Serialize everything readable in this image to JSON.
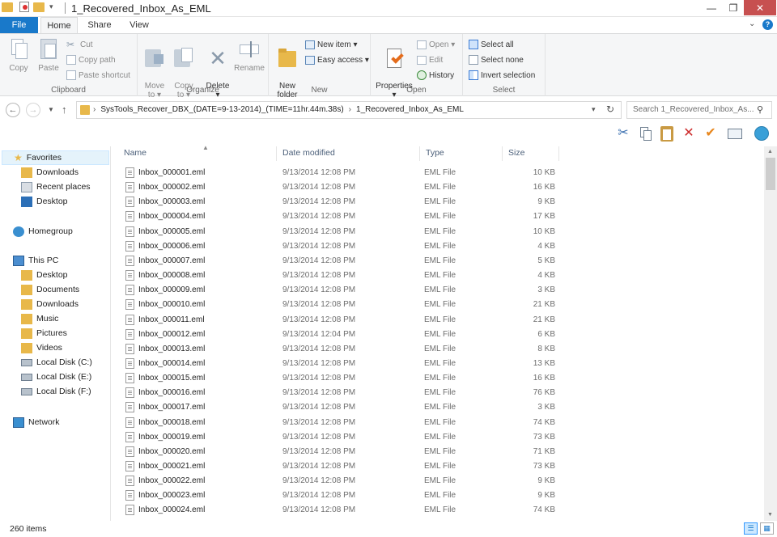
{
  "window": {
    "title": "1_Recovered_Inbox_As_EML",
    "min_glyph": "—",
    "max_glyph": "❐",
    "close_glyph": "✕"
  },
  "ribbon_tabs": {
    "file": "File",
    "home": "Home",
    "share": "Share",
    "view": "View",
    "help": "?"
  },
  "ribbon": {
    "clipboard": {
      "label": "Clipboard",
      "copy": "Copy",
      "paste": "Paste",
      "cut": "Cut",
      "copy_path": "Copy path",
      "paste_shortcut": "Paste shortcut"
    },
    "organize": {
      "label": "Organize",
      "move_to": "Move\nto ▾",
      "copy_to": "Copy\nto ▾",
      "delete": "Delete\n▾",
      "rename": "Rename"
    },
    "new": {
      "label": "New",
      "new_folder": "New\nfolder",
      "new_item": "New item ▾",
      "easy_access": "Easy access ▾"
    },
    "open": {
      "label": "Open",
      "properties": "Properties\n▾",
      "open": "Open ▾",
      "edit": "Edit",
      "history": "History"
    },
    "select": {
      "label": "Select",
      "select_all": "Select all",
      "select_none": "Select none",
      "invert_selection": "Invert selection"
    }
  },
  "address": {
    "crumbs": [
      "SysTools_Recover_DBX_(DATE=9-13-2014)_(TIME=11hr.44m.38s)",
      "1_Recovered_Inbox_As_EML"
    ],
    "search_placeholder": "Search 1_Recovered_Inbox_As..."
  },
  "nav": {
    "favorites": "Favorites",
    "favorites_items": [
      "Downloads",
      "Recent places",
      "Desktop"
    ],
    "homegroup": "Homegroup",
    "this_pc": "This PC",
    "this_pc_items": [
      "Desktop",
      "Documents",
      "Downloads",
      "Music",
      "Pictures",
      "Videos",
      "Local Disk (C:)",
      "Local Disk (E:)",
      "Local Disk (F:)"
    ],
    "network": "Network"
  },
  "columns": {
    "name": "Name",
    "date_modified": "Date modified",
    "type": "Type",
    "size": "Size"
  },
  "files": [
    {
      "name": "Inbox_000001.eml",
      "date": "9/13/2014 12:08 PM",
      "type": "EML File",
      "size": "10 KB"
    },
    {
      "name": "Inbox_000002.eml",
      "date": "9/13/2014 12:08 PM",
      "type": "EML File",
      "size": "16 KB"
    },
    {
      "name": "Inbox_000003.eml",
      "date": "9/13/2014 12:08 PM",
      "type": "EML File",
      "size": "9 KB"
    },
    {
      "name": "Inbox_000004.eml",
      "date": "9/13/2014 12:08 PM",
      "type": "EML File",
      "size": "17 KB"
    },
    {
      "name": "Inbox_000005.eml",
      "date": "9/13/2014 12:08 PM",
      "type": "EML File",
      "size": "10 KB"
    },
    {
      "name": "Inbox_000006.eml",
      "date": "9/13/2014 12:08 PM",
      "type": "EML File",
      "size": "4 KB"
    },
    {
      "name": "Inbox_000007.eml",
      "date": "9/13/2014 12:08 PM",
      "type": "EML File",
      "size": "5 KB"
    },
    {
      "name": "Inbox_000008.eml",
      "date": "9/13/2014 12:08 PM",
      "type": "EML File",
      "size": "4 KB"
    },
    {
      "name": "Inbox_000009.eml",
      "date": "9/13/2014 12:08 PM",
      "type": "EML File",
      "size": "3 KB"
    },
    {
      "name": "Inbox_000010.eml",
      "date": "9/13/2014 12:08 PM",
      "type": "EML File",
      "size": "21 KB"
    },
    {
      "name": "Inbox_000011.eml",
      "date": "9/13/2014 12:08 PM",
      "type": "EML File",
      "size": "21 KB"
    },
    {
      "name": "Inbox_000012.eml",
      "date": "9/13/2014 12:04 PM",
      "type": "EML File",
      "size": "6 KB"
    },
    {
      "name": "Inbox_000013.eml",
      "date": "9/13/2014 12:08 PM",
      "type": "EML File",
      "size": "8 KB"
    },
    {
      "name": "Inbox_000014.eml",
      "date": "9/13/2014 12:08 PM",
      "type": "EML File",
      "size": "13 KB"
    },
    {
      "name": "Inbox_000015.eml",
      "date": "9/13/2014 12:08 PM",
      "type": "EML File",
      "size": "16 KB"
    },
    {
      "name": "Inbox_000016.eml",
      "date": "9/13/2014 12:08 PM",
      "type": "EML File",
      "size": "76 KB"
    },
    {
      "name": "Inbox_000017.eml",
      "date": "9/13/2014 12:08 PM",
      "type": "EML File",
      "size": "3 KB"
    },
    {
      "name": "Inbox_000018.eml",
      "date": "9/13/2014 12:08 PM",
      "type": "EML File",
      "size": "74 KB"
    },
    {
      "name": "Inbox_000019.eml",
      "date": "9/13/2014 12:08 PM",
      "type": "EML File",
      "size": "73 KB"
    },
    {
      "name": "Inbox_000020.eml",
      "date": "9/13/2014 12:08 PM",
      "type": "EML File",
      "size": "71 KB"
    },
    {
      "name": "Inbox_000021.eml",
      "date": "9/13/2014 12:08 PM",
      "type": "EML File",
      "size": "73 KB"
    },
    {
      "name": "Inbox_000022.eml",
      "date": "9/13/2014 12:08 PM",
      "type": "EML File",
      "size": "9 KB"
    },
    {
      "name": "Inbox_000023.eml",
      "date": "9/13/2014 12:08 PM",
      "type": "EML File",
      "size": "9 KB"
    },
    {
      "name": "Inbox_000024.eml",
      "date": "9/13/2014 12:08 PM",
      "type": "EML File",
      "size": "74 KB"
    }
  ],
  "status": {
    "item_count": "260 items"
  },
  "colors": {
    "accent": "#1979ca",
    "close": "#c75050",
    "folder": "#e8b84a"
  }
}
